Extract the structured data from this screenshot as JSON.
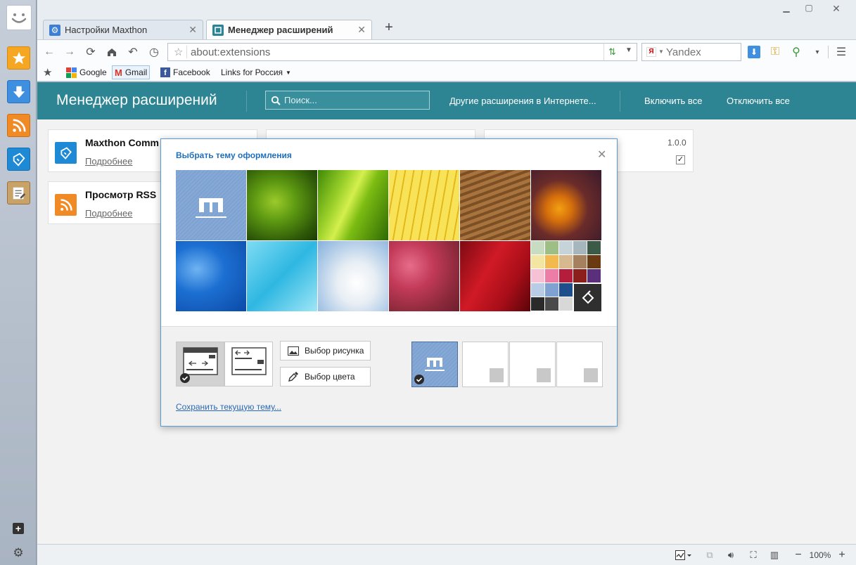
{
  "tabs": [
    {
      "label": "Настройки Maxthon",
      "active": false
    },
    {
      "label": "Менеджер расширений",
      "active": true
    }
  ],
  "toolbar": {
    "address": "about:extensions",
    "search_placeholder": "Yandex"
  },
  "bookmarks": [
    {
      "label": "Google",
      "icon": "google-icon"
    },
    {
      "label": "Gmail",
      "icon": "gmail-icon"
    },
    {
      "label": "Facebook",
      "icon": "facebook-icon"
    },
    {
      "label": "Links for Россия",
      "icon": "dropdown-arrow"
    }
  ],
  "header": {
    "title": "Менеджер расширений",
    "search_placeholder": "Поиск...",
    "more_link": "Другие расширения в Интернете...",
    "enable_all": "Включить все",
    "disable_all": "Отключить все",
    "color": "#2d8594"
  },
  "extensions": [
    {
      "name": "Maxthon Comm",
      "more": "Подробнее",
      "icon": "maxthon-icon"
    },
    {
      "name": "Просмотр RSS",
      "more": "Подробнее",
      "icon": "rss-icon"
    }
  ],
  "third_card": {
    "version": "1.0.0",
    "enabled": true
  },
  "modal": {
    "title": "Выбрать тему оформления",
    "pick_image": "Выбор рисунка",
    "pick_color": "Выбор цвета",
    "save_theme": "Сохранить текущую тему...",
    "accent": "#1d6fbd",
    "themes": [
      "maxthon-default",
      "grass",
      "green-leaf",
      "yellow-petals",
      "sand-dunes",
      "orange-bokeh",
      "blue-water",
      "ice-crystals",
      "clouds",
      "cherry-blossom",
      "red-petal",
      "color-palette"
    ],
    "palette": [
      "#c7dcc0",
      "#9dbf85",
      "#c6d3d8",
      "#a6b6bd",
      "#3c5a48",
      "#f3e6a3",
      "#f2b94f",
      "#d6b98e",
      "#a68160",
      "#6a3a12",
      "#f6c1d4",
      "#ec7da6",
      "#b41d3b",
      "#8c1f1c",
      "#5a2f7c",
      "#b9cce6",
      "#7fa2d2",
      "#1e4e8c",
      "#2a2a2a",
      "#4a4a4a",
      "#d8d8d8",
      "#bdbdbd",
      "#323232"
    ]
  },
  "status": {
    "zoom": "100%"
  }
}
